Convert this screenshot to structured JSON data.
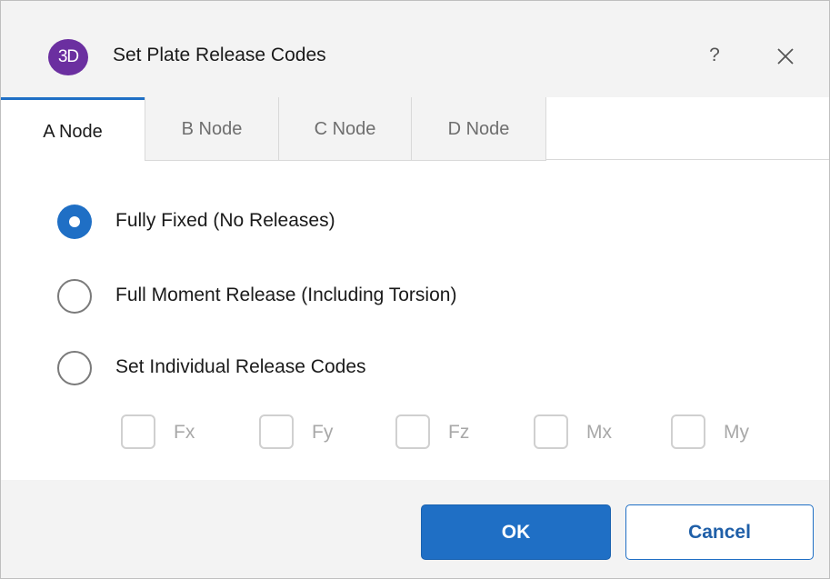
{
  "window": {
    "app_icon_text": "3D",
    "title": "Set Plate Release Codes",
    "help_label": "?",
    "accent_color": "#1f6fc5",
    "app_icon_color": "#6b2fa0"
  },
  "tabs": [
    {
      "label": "A Node",
      "active": true
    },
    {
      "label": "B Node",
      "active": false
    },
    {
      "label": "C Node",
      "active": false
    },
    {
      "label": "D Node",
      "active": false
    }
  ],
  "release_options": [
    {
      "label": "Fully Fixed (No Releases)",
      "selected": true
    },
    {
      "label": "Full Moment Release (Including Torsion)",
      "selected": false
    },
    {
      "label": "Set Individual Release Codes",
      "selected": false
    }
  ],
  "individual_codes": [
    {
      "label": "Fx",
      "checked": false,
      "enabled": false
    },
    {
      "label": "Fy",
      "checked": false,
      "enabled": false
    },
    {
      "label": "Fz",
      "checked": false,
      "enabled": false
    },
    {
      "label": "Mx",
      "checked": false,
      "enabled": false
    },
    {
      "label": "My",
      "checked": false,
      "enabled": false
    }
  ],
  "buttons": {
    "ok_label": "OK",
    "cancel_label": "Cancel"
  }
}
